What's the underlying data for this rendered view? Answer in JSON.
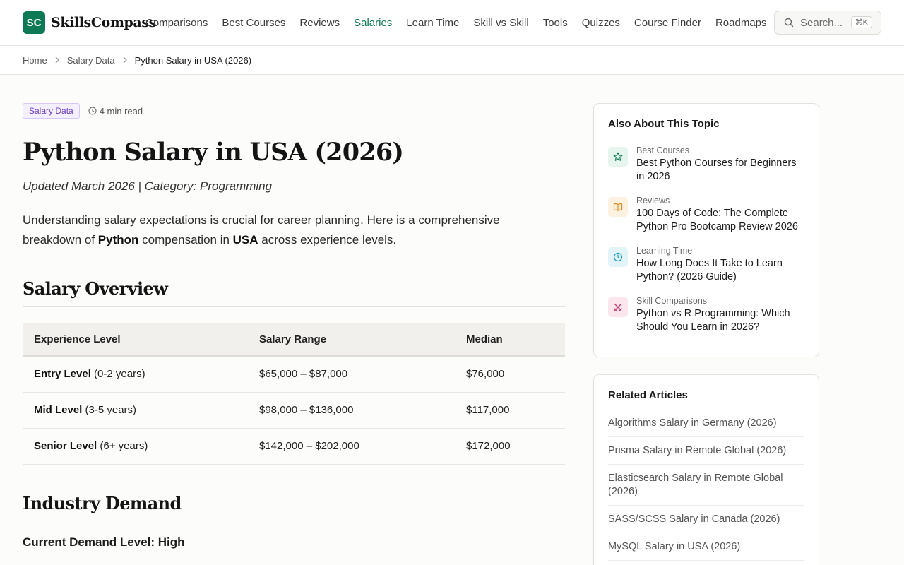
{
  "site": {
    "logo_badge": "SC",
    "logo_text": "SkillsCompass"
  },
  "nav": {
    "items": [
      "Comparisons",
      "Best Courses",
      "Reviews",
      "Salaries",
      "Learn Time",
      "Skill vs Skill",
      "Tools",
      "Quizzes",
      "Course Finder",
      "Roadmaps"
    ],
    "active": "Salaries"
  },
  "search": {
    "placeholder": "Search...",
    "shortcut": "⌘K"
  },
  "breadcrumb": {
    "home": "Home",
    "section": "Salary Data",
    "current": "Python Salary in USA (2026)"
  },
  "article": {
    "tag": "Salary Data",
    "read_time": "4 min read",
    "title": "Python Salary in USA (2026)",
    "updated": "Updated March 2026 | Category: Programming",
    "intro_1": "Understanding salary expectations is crucial for career planning. Here is a comprehensive breakdown of ",
    "intro_skill": "Python",
    "intro_2": " compensation in ",
    "intro_country": "USA",
    "intro_3": " across experience levels.",
    "section_overview": "Salary Overview",
    "table": {
      "headers": [
        "Experience Level",
        "Salary Range",
        "Median"
      ],
      "rows": [
        {
          "level": "Entry Level",
          "years": " (0-2 years)",
          "range": "$65,000 – $87,000",
          "median": "$76,000"
        },
        {
          "level": "Mid Level",
          "years": " (3-5 years)",
          "range": "$98,000 – $136,000",
          "median": "$117,000"
        },
        {
          "level": "Senior Level",
          "years": " (6+ years)",
          "range": "$142,000 – $202,000",
          "median": "$172,000"
        }
      ]
    },
    "section_demand": "Industry Demand",
    "demand_level": "Current Demand Level: High"
  },
  "sidebar": {
    "topic_title": "Also About This Topic",
    "topics": [
      {
        "category": "Best Courses",
        "title": "Best Python Courses for Beginners in 2026",
        "icon": "star-icon",
        "color": "#0e7a55",
        "bg": "#e6f6ef"
      },
      {
        "category": "Reviews",
        "title": "100 Days of Code: The Complete Python Pro Bootcamp Review 2026",
        "icon": "book-icon",
        "color": "#e08a1e",
        "bg": "#fdf1e0"
      },
      {
        "category": "Learning Time",
        "title": "How Long Does It Take to Learn Python? (2026 Guide)",
        "icon": "clock-icon",
        "color": "#1a9bb8",
        "bg": "#e2f4f8"
      },
      {
        "category": "Skill Comparisons",
        "title": "Python vs R Programming: Which Should You Learn in 2026?",
        "icon": "swords-icon",
        "color": "#d6336c",
        "bg": "#fbe6ee"
      }
    ],
    "related_title": "Related Articles",
    "related": [
      "Algorithms Salary in Germany (2026)",
      "Prisma Salary in Remote Global (2026)",
      "Elasticsearch Salary in Remote Global (2026)",
      "SASS/SCSS Salary in Canada (2026)",
      "MySQL Salary in USA (2026)"
    ]
  }
}
